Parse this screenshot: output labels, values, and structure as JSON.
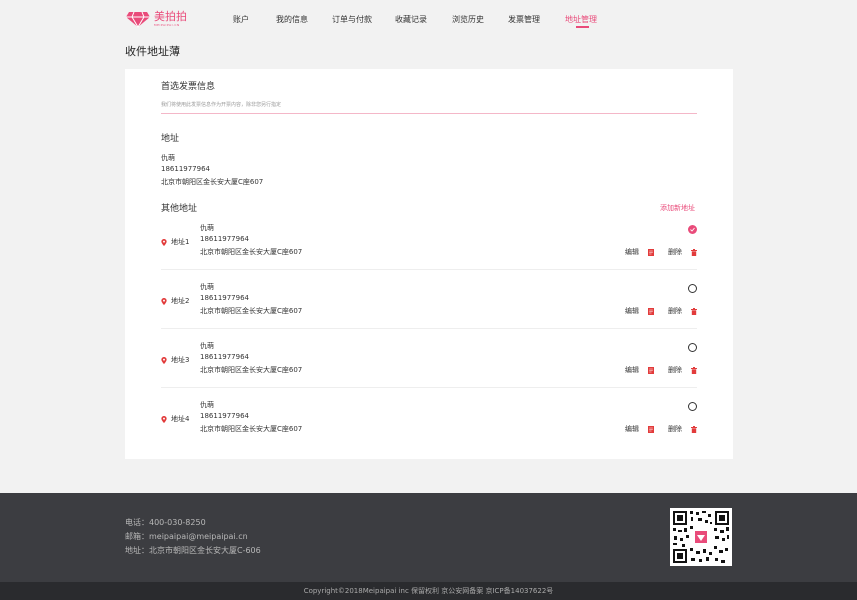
{
  "brand": {
    "name": "美拍拍",
    "tagline": "MEIPAIPAI.CN",
    "color": "#e94b7a"
  },
  "nav": {
    "items": [
      "账户",
      "我的信息",
      "订单与付款",
      "收藏记录",
      "浏览历史",
      "发票管理",
      "地址管理"
    ],
    "active": "地址管理"
  },
  "page_title": "收件地址薄",
  "preferred": {
    "title": "首选发票信息",
    "hint": "我们将使用此发票信息作为开票内容，除非您另行指定"
  },
  "address_section": {
    "title": "地址",
    "name": "仇萌",
    "phone": "18611977964",
    "address": "北京市朝阳区金长安大厦C座607"
  },
  "others": {
    "title": "其他地址",
    "add_label": "添加新地址",
    "edit_label": "编辑",
    "delete_label": "删除",
    "rows": [
      {
        "label": "地址1",
        "name": "仇萌",
        "phone": "18611977964",
        "address": "北京市朝阳区金长安大厦C座607",
        "selected": true
      },
      {
        "label": "地址2",
        "name": "仇萌",
        "phone": "18611977964",
        "address": "北京市朝阳区金长安大厦C座607",
        "selected": false
      },
      {
        "label": "地址3",
        "name": "仇萌",
        "phone": "18611977964",
        "address": "北京市朝阳区金长安大厦C座607",
        "selected": false
      },
      {
        "label": "地址4",
        "name": "仇萌",
        "phone": "18611977964",
        "address": "北京市朝阳区金长安大厦C座607",
        "selected": false
      }
    ]
  },
  "footer": {
    "phone": "电话：400-030-8250",
    "email": "邮箱：meipaipai@meipaipai.cn",
    "address": "地址：北京市朝阳区金长安大厦C-606",
    "copyright": "Copyright©2018Meipaipai inc 保留权利 京公安网备案 京ICP备14037622号"
  },
  "icons": {
    "location": "location-pin-icon",
    "edit": "edit-doc-icon",
    "delete": "trash-icon",
    "check": "check-icon"
  }
}
